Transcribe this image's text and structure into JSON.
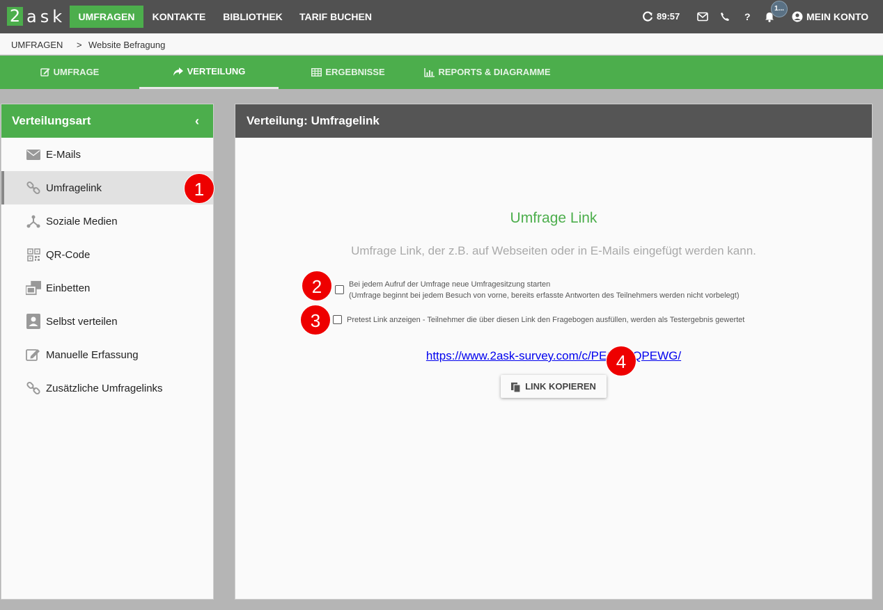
{
  "topnav": {
    "logo_digit": "2",
    "logo_text": "ask",
    "items": [
      {
        "label": "UMFRAGEN",
        "active": true
      },
      {
        "label": "KONTAKTE",
        "active": false
      },
      {
        "label": "BIBLIOTHEK",
        "active": false
      },
      {
        "label": "TARIF BUCHEN",
        "active": false
      }
    ],
    "timer": "89:57",
    "notification_count": "1...",
    "account_label": "MEIN KONTO"
  },
  "breadcrumb": {
    "root": "UMFRAGEN",
    "separator": ">",
    "current": "Website Befragung"
  },
  "tabs": [
    {
      "label": "UMFRAGE",
      "icon": "edit-icon",
      "active": false
    },
    {
      "label": "VERTEILUNG",
      "icon": "share-icon",
      "active": true
    },
    {
      "label": "ERGEBNISSE",
      "icon": "table-icon",
      "active": false
    },
    {
      "label": "REPORTS & DIAGRAMME",
      "icon": "bar-chart-icon",
      "active": false
    }
  ],
  "sidebar": {
    "title": "Verteilungsart",
    "collapse_glyph": "‹",
    "items": [
      {
        "label": "E-Mails",
        "icon": "envelope-icon",
        "active": false
      },
      {
        "label": "Umfragelink",
        "icon": "link-icon",
        "active": true
      },
      {
        "label": "Soziale Medien",
        "icon": "share-nodes-icon",
        "active": false
      },
      {
        "label": "QR-Code",
        "icon": "qrcode-icon",
        "active": false
      },
      {
        "label": "Einbetten",
        "icon": "embed-icon",
        "active": false
      },
      {
        "label": "Selbst verteilen",
        "icon": "user-card-icon",
        "active": false
      },
      {
        "label": "Manuelle Erfassung",
        "icon": "pencil-square-icon",
        "active": false
      },
      {
        "label": "Zusätzliche Umfragelinks",
        "icon": "link-icon",
        "active": false
      }
    ]
  },
  "panel": {
    "title": "Verteilung: Umfragelink",
    "heading": "Umfrage Link",
    "subheading": "Umfrage Link, der z.B. auf Webseiten oder in E-Mails eingefügt werden kann.",
    "option1_line1": "Bei jedem Aufruf der Umfrage neue Umfragesitzung starten",
    "option1_line2": "(Umfrage beginnt bei jedem Besuch von vorne, bereits erfasste Antworten des Teilnehmers werden nicht vorbelegt)",
    "option1_checked": false,
    "option2_text": "Pretest Link anzeigen - Teilnehmer die über diesen Link den Fragebogen ausfüllen, werden als Testergebnis gewertet",
    "option2_checked": false,
    "survey_link": "https://www.2ask-survey.com/c/PE6    SBQPEWG/",
    "copy_button": "LINK KOPIEREN"
  },
  "markers": [
    "1",
    "2",
    "3",
    "4"
  ],
  "colors": {
    "brand_green": "#4cae4c",
    "topbar_dark": "#515151",
    "panel_header": "#555555",
    "marker_red": "#ee0000"
  }
}
